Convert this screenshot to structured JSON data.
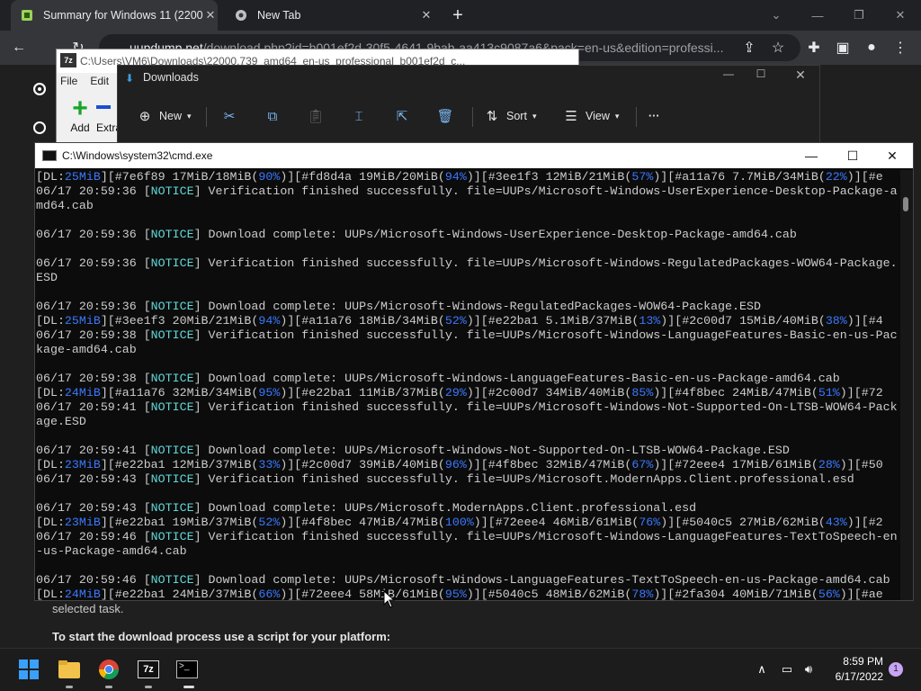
{
  "browser": {
    "tabs": [
      {
        "label": "Summary for Windows 11 (22000",
        "close": "✕"
      },
      {
        "label": "New Tab",
        "close": "✕"
      }
    ],
    "new_tab": "+",
    "url_host": "uupdump.net",
    "url_path": "/download.php?id=b001ef2d-30f5-4641-9bab-aa413c9087a6&pack=en-us&edition=professi..."
  },
  "page": {
    "text1": "selected task.",
    "text2": "To start the download process use a script for your platform:"
  },
  "zip": {
    "title": "C:\\Users\\VM6\\Downloads\\22000.739_amd64_en-us_professional_b001ef2d_c...",
    "icon": "7z",
    "menu": [
      "File",
      "Edit"
    ],
    "add_label": "Add",
    "extract_label": "Extra"
  },
  "downloads": {
    "title": "Downloads",
    "toolbar": {
      "new": "New",
      "sort": "Sort",
      "view": "View",
      "more": "···"
    }
  },
  "cmd": {
    "title": "C:\\Windows\\system32\\cmd.exe",
    "lines": [
      [
        [
          "d",
          "[DL:"
        ],
        [
          "dl",
          "25MiB"
        ],
        [
          "d",
          "][#7e6f89 17MiB/18MiB("
        ],
        [
          "dl",
          "90%"
        ],
        [
          "d",
          ")][#fd8d4a 19MiB/20MiB("
        ],
        [
          "dl",
          "94%"
        ],
        [
          "d",
          ")][#3ee1f3 12MiB/21MiB("
        ],
        [
          "dl",
          "57%"
        ],
        [
          "d",
          ")][#a11a76 7.7MiB/34MiB("
        ],
        [
          "dl",
          "22%"
        ],
        [
          "d",
          ")][#e"
        ]
      ],
      [
        [
          "d",
          "06/17 20:59:36 ["
        ],
        [
          "n",
          "NOTICE"
        ],
        [
          "d",
          "] Verification finished successfully. file=UUPs/Microsoft-Windows-UserExperience-Desktop-Package-a"
        ]
      ],
      [
        [
          "d",
          "md64.cab"
        ]
      ],
      [
        [
          "d",
          ""
        ]
      ],
      [
        [
          "d",
          "06/17 20:59:36 ["
        ],
        [
          "n",
          "NOTICE"
        ],
        [
          "d",
          "] Download complete: UUPs/Microsoft-Windows-UserExperience-Desktop-Package-amd64.cab"
        ]
      ],
      [
        [
          "d",
          ""
        ]
      ],
      [
        [
          "d",
          "06/17 20:59:36 ["
        ],
        [
          "n",
          "NOTICE"
        ],
        [
          "d",
          "] Verification finished successfully. file=UUPs/Microsoft-Windows-RegulatedPackages-WOW64-Package."
        ]
      ],
      [
        [
          "d",
          "ESD"
        ]
      ],
      [
        [
          "d",
          ""
        ]
      ],
      [
        [
          "d",
          "06/17 20:59:36 ["
        ],
        [
          "n",
          "NOTICE"
        ],
        [
          "d",
          "] Download complete: UUPs/Microsoft-Windows-RegulatedPackages-WOW64-Package.ESD"
        ]
      ],
      [
        [
          "d",
          "[DL:"
        ],
        [
          "dl",
          "25MiB"
        ],
        [
          "d",
          "][#3ee1f3 20MiB/21MiB("
        ],
        [
          "dl",
          "94%"
        ],
        [
          "d",
          ")][#a11a76 18MiB/34MiB("
        ],
        [
          "dl",
          "52%"
        ],
        [
          "d",
          ")][#e22ba1 5.1MiB/37MiB("
        ],
        [
          "dl",
          "13%"
        ],
        [
          "d",
          ")][#2c00d7 15MiB/40MiB("
        ],
        [
          "dl",
          "38%"
        ],
        [
          "d",
          ")][#4"
        ]
      ],
      [
        [
          "d",
          "06/17 20:59:38 ["
        ],
        [
          "n",
          "NOTICE"
        ],
        [
          "d",
          "] Verification finished successfully. file=UUPs/Microsoft-Windows-LanguageFeatures-Basic-en-us-Pac"
        ]
      ],
      [
        [
          "d",
          "kage-amd64.cab"
        ]
      ],
      [
        [
          "d",
          ""
        ]
      ],
      [
        [
          "d",
          "06/17 20:59:38 ["
        ],
        [
          "n",
          "NOTICE"
        ],
        [
          "d",
          "] Download complete: UUPs/Microsoft-Windows-LanguageFeatures-Basic-en-us-Package-amd64.cab"
        ]
      ],
      [
        [
          "d",
          "[DL:"
        ],
        [
          "dl",
          "24MiB"
        ],
        [
          "d",
          "][#a11a76 32MiB/34MiB("
        ],
        [
          "dl",
          "95%"
        ],
        [
          "d",
          ")][#e22ba1 11MiB/37MiB("
        ],
        [
          "dl",
          "29%"
        ],
        [
          "d",
          ")][#2c00d7 34MiB/40MiB("
        ],
        [
          "dl",
          "85%"
        ],
        [
          "d",
          ")][#4f8bec 24MiB/47MiB("
        ],
        [
          "dl",
          "51%"
        ],
        [
          "d",
          ")][#72"
        ]
      ],
      [
        [
          "d",
          "06/17 20:59:41 ["
        ],
        [
          "n",
          "NOTICE"
        ],
        [
          "d",
          "] Verification finished successfully. file=UUPs/Microsoft-Windows-Not-Supported-On-LTSB-WOW64-Pack"
        ]
      ],
      [
        [
          "d",
          "age.ESD"
        ]
      ],
      [
        [
          "d",
          ""
        ]
      ],
      [
        [
          "d",
          "06/17 20:59:41 ["
        ],
        [
          "n",
          "NOTICE"
        ],
        [
          "d",
          "] Download complete: UUPs/Microsoft-Windows-Not-Supported-On-LTSB-WOW64-Package.ESD"
        ]
      ],
      [
        [
          "d",
          "[DL:"
        ],
        [
          "dl",
          "23MiB"
        ],
        [
          "d",
          "][#e22ba1 12MiB/37MiB("
        ],
        [
          "dl",
          "33%"
        ],
        [
          "d",
          ")][#2c00d7 39MiB/40MiB("
        ],
        [
          "dl",
          "96%"
        ],
        [
          "d",
          ")][#4f8bec 32MiB/47MiB("
        ],
        [
          "dl",
          "67%"
        ],
        [
          "d",
          ")][#72eee4 17MiB/61MiB("
        ],
        [
          "dl",
          "28%"
        ],
        [
          "d",
          ")][#50"
        ]
      ],
      [
        [
          "d",
          "06/17 20:59:43 ["
        ],
        [
          "n",
          "NOTICE"
        ],
        [
          "d",
          "] Verification finished successfully. file=UUPs/Microsoft.ModernApps.Client.professional.esd"
        ]
      ],
      [
        [
          "d",
          ""
        ]
      ],
      [
        [
          "d",
          "06/17 20:59:43 ["
        ],
        [
          "n",
          "NOTICE"
        ],
        [
          "d",
          "] Download complete: UUPs/Microsoft.ModernApps.Client.professional.esd"
        ]
      ],
      [
        [
          "d",
          "[DL:"
        ],
        [
          "dl",
          "23MiB"
        ],
        [
          "d",
          "][#e22ba1 19MiB/37MiB("
        ],
        [
          "dl",
          "52%"
        ],
        [
          "d",
          ")][#4f8bec 47MiB/47MiB("
        ],
        [
          "dl",
          "100%"
        ],
        [
          "d",
          ")][#72eee4 46MiB/61MiB("
        ],
        [
          "dl",
          "76%"
        ],
        [
          "d",
          ")][#5040c5 27MiB/62MiB("
        ],
        [
          "dl",
          "43%"
        ],
        [
          "d",
          ")][#2"
        ]
      ],
      [
        [
          "d",
          "06/17 20:59:46 ["
        ],
        [
          "n",
          "NOTICE"
        ],
        [
          "d",
          "] Verification finished successfully. file=UUPs/Microsoft-Windows-LanguageFeatures-TextToSpeech-en"
        ]
      ],
      [
        [
          "d",
          "-us-Package-amd64.cab"
        ]
      ],
      [
        [
          "d",
          ""
        ]
      ],
      [
        [
          "d",
          "06/17 20:59:46 ["
        ],
        [
          "n",
          "NOTICE"
        ],
        [
          "d",
          "] Download complete: UUPs/Microsoft-Windows-LanguageFeatures-TextToSpeech-en-us-Package-amd64.cab"
        ]
      ],
      [
        [
          "d",
          "[DL:"
        ],
        [
          "dl",
          "24MiB"
        ],
        [
          "d",
          "][#e22ba1 24MiB/37MiB("
        ],
        [
          "dl",
          "66%"
        ],
        [
          "d",
          ")][#72eee4 58MiB/61MiB("
        ],
        [
          "dl",
          "95%"
        ],
        [
          "d",
          ")][#5040c5 48MiB/62MiB("
        ],
        [
          "dl",
          "78%"
        ],
        [
          "d",
          ")][#2fa304 40MiB/71MiB("
        ],
        [
          "dl",
          "56%"
        ],
        [
          "d",
          ")][#ae"
        ]
      ]
    ]
  },
  "taskbar": {
    "time": "8:59 PM",
    "date": "6/17/2022",
    "notifications": "1",
    "zip_label": "7z"
  },
  "colors": {
    "notice": "#61d6d6",
    "dl_value": "#3b78ff",
    "console_text": "#cccccc",
    "console_bg": "#0c0c0c"
  }
}
